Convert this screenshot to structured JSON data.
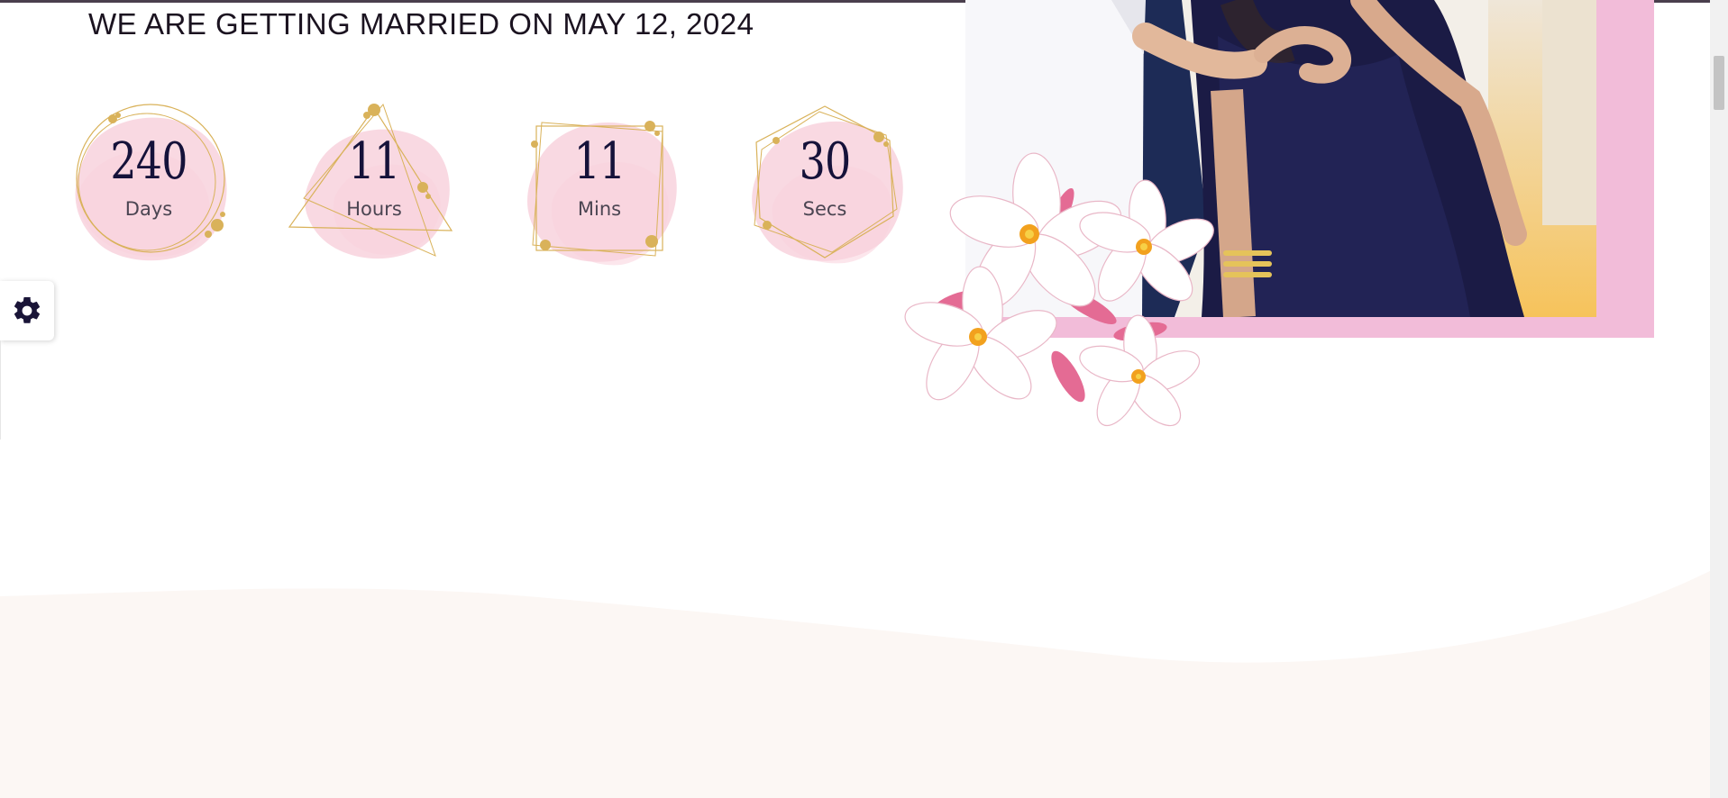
{
  "announcement": {
    "headline": "WE ARE GETTING MARRIED ON MAY 12, 2024"
  },
  "countdown": [
    {
      "value": "240",
      "unit": "Days"
    },
    {
      "value": "11",
      "unit": "Hours"
    },
    {
      "value": "11",
      "unit": "Mins"
    },
    {
      "value": "30",
      "unit": "Secs"
    }
  ],
  "settings": {
    "icon": "gear-icon"
  },
  "colors": {
    "accent_pink": "#f2bcd9",
    "watercolor_pink": "#f7c9d6",
    "gold": "#d9b25a",
    "number_navy": "#15123a",
    "section_background": "#fcf7f4"
  }
}
